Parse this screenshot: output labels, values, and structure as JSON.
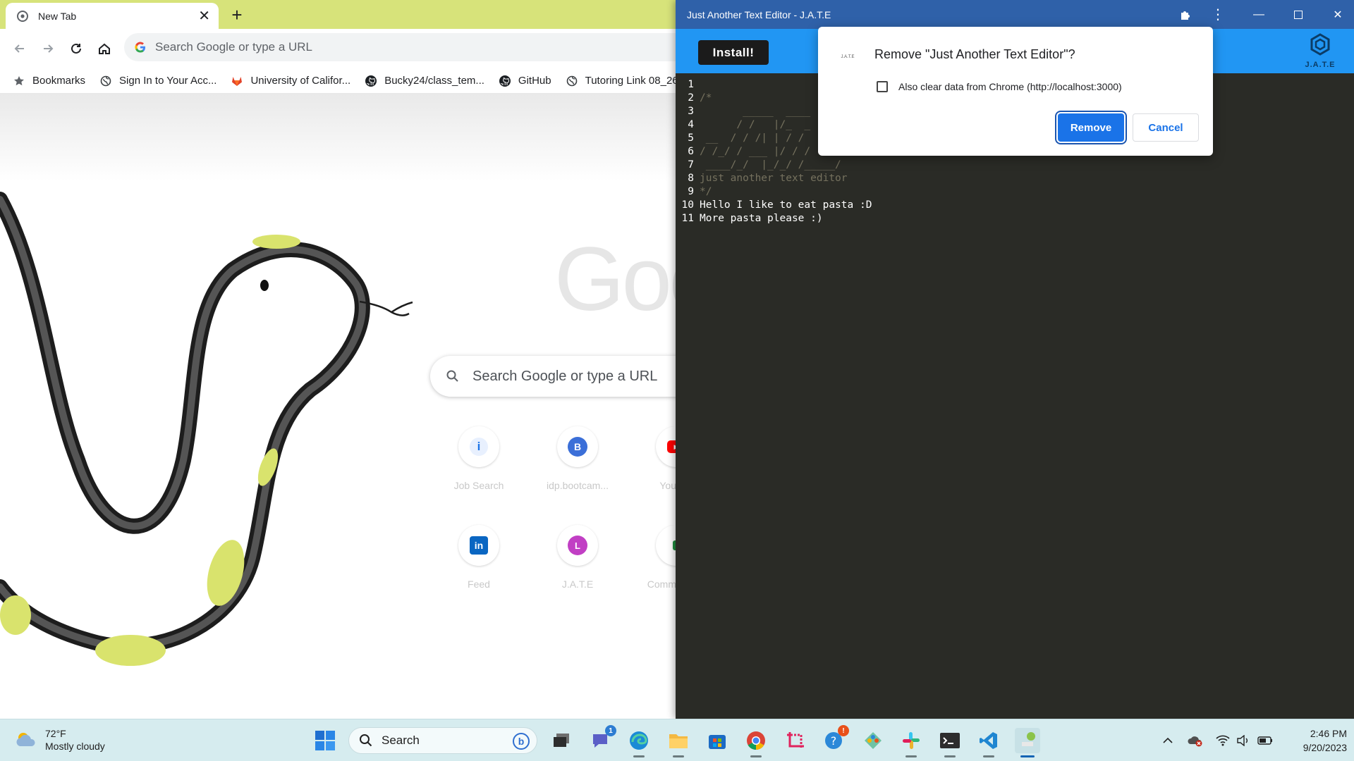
{
  "browser": {
    "tab_title": "New Tab",
    "omnibox_placeholder": "Search Google or type a URL",
    "bookmarks": [
      {
        "label": "Bookmarks",
        "icon": "star-icon"
      },
      {
        "label": "Sign In to Your Acc...",
        "icon": "globe-icon"
      },
      {
        "label": "University of Califor...",
        "icon": "gitlab-icon"
      },
      {
        "label": "Bucky24/class_tem...",
        "icon": "github-icon"
      },
      {
        "label": "GitHub",
        "icon": "github-icon"
      },
      {
        "label": "Tutoring Link 08_26",
        "icon": "globe-icon"
      }
    ],
    "ntp": {
      "logo_text": "Goo",
      "search_placeholder": "Search Google or type a URL",
      "shortcuts": [
        {
          "label": "Job Search",
          "glyph": "i",
          "color": "#1a73e8"
        },
        {
          "label": "idp.bootcam...",
          "glyph": "B",
          "color": "#3b6fd8"
        },
        {
          "label": "You",
          "glyph": "▶",
          "color": "#ff0000"
        },
        {
          "label": "Feed",
          "glyph": "in",
          "color": "#0a66c2"
        },
        {
          "label": "J.A.T.E",
          "glyph": "L",
          "color": "#c13fc4"
        },
        {
          "label": "Comm",
          "glyph": "",
          "color": "#1e8e3e"
        }
      ]
    }
  },
  "jate": {
    "window_title": "Just Another Text Editor - J.A.T.E",
    "install_label": "Install!",
    "logo_text": "J.A.T.E",
    "lines": [
      {
        "n": "1",
        "text": "",
        "comment": false
      },
      {
        "n": "2",
        "text": "/*",
        "comment": true
      },
      {
        "n": "3",
        "text": "       _____  ____",
        "comment": true
      },
      {
        "n": "4",
        "text": "      / /   |/_  _",
        "comment": true
      },
      {
        "n": "5",
        "text": " __  / / /| | / /",
        "comment": true
      },
      {
        "n": "6",
        "text": "/ /_/ / ___ |/ / /",
        "comment": true
      },
      {
        "n": "7",
        "text": " ____/_/  |_/_/ /_____/",
        "comment": true
      },
      {
        "n": "8",
        "text": "just another text editor",
        "comment": true
      },
      {
        "n": "9",
        "text": "*/",
        "comment": true
      },
      {
        "n": "10",
        "text": "Hello I like to eat pasta :D",
        "comment": false
      },
      {
        "n": "11",
        "text": "More pasta please :)",
        "comment": false
      }
    ]
  },
  "dialog": {
    "app_icon_text": "J.A.T.E",
    "title": "Remove \"Just Another Text Editor\"?",
    "checkbox_label": "Also clear data from Chrome (http://localhost:3000)",
    "remove_label": "Remove",
    "cancel_label": "Cancel"
  },
  "taskbar": {
    "weather_temp": "72°F",
    "weather_desc": "Mostly cloudy",
    "search_label": "Search",
    "chat_badge": "1",
    "time": "2:46 PM",
    "date": "9/20/2023"
  }
}
